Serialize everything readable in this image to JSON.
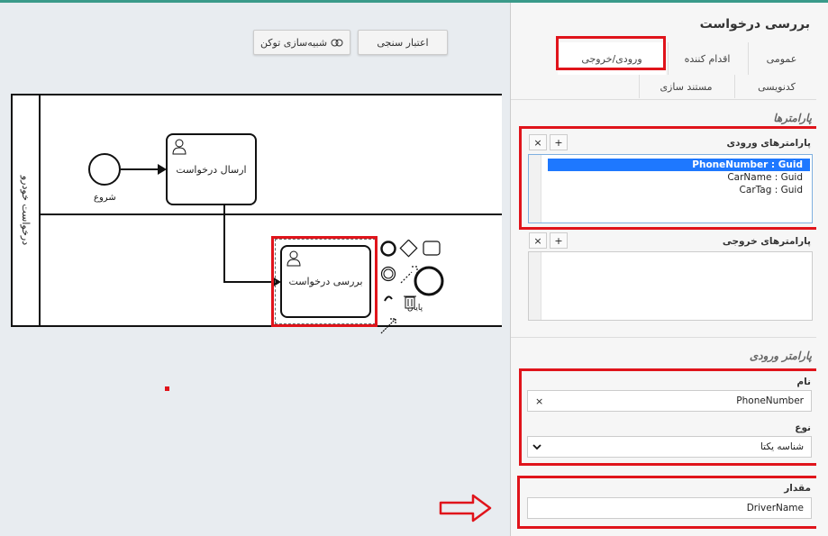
{
  "toolbar": {
    "token_sim_label": "شبیه‌سازی توکن",
    "validate_label": "اعتبار سنجی"
  },
  "diagram": {
    "pool_label": "درخواست خودرو",
    "start_label": "شروع",
    "task1_label": "ارسال درخواست",
    "task2_label": "بررسی درخواست",
    "end_label": "پایان"
  },
  "panel": {
    "title": "بررسی درخواست",
    "tabs": [
      "عمومی",
      "ورودی/خروجی",
      "اقدام کننده",
      "کدنویسی",
      "مستند سازی"
    ],
    "params_section": "پارامترها",
    "input_params_label": "پارامترهای ورودی",
    "input_params": [
      "PhoneNumber : Guid",
      "CarName : Guid",
      "CarTag : Guid"
    ],
    "output_params_label": "پارامترهای خروجی",
    "add_symbol": "+",
    "remove_symbol": "×",
    "input_param_section": "پارامتر ورودی",
    "name_label": "نام",
    "name_value": "PhoneNumber",
    "type_label": "نوع",
    "type_value": "شناسه یکتا",
    "value_label": "مقدار",
    "value_value": "DriverName"
  },
  "colors": {
    "highlight": "#e0141b",
    "selection": "#1e78ff",
    "accent": "#3a9a8a"
  }
}
